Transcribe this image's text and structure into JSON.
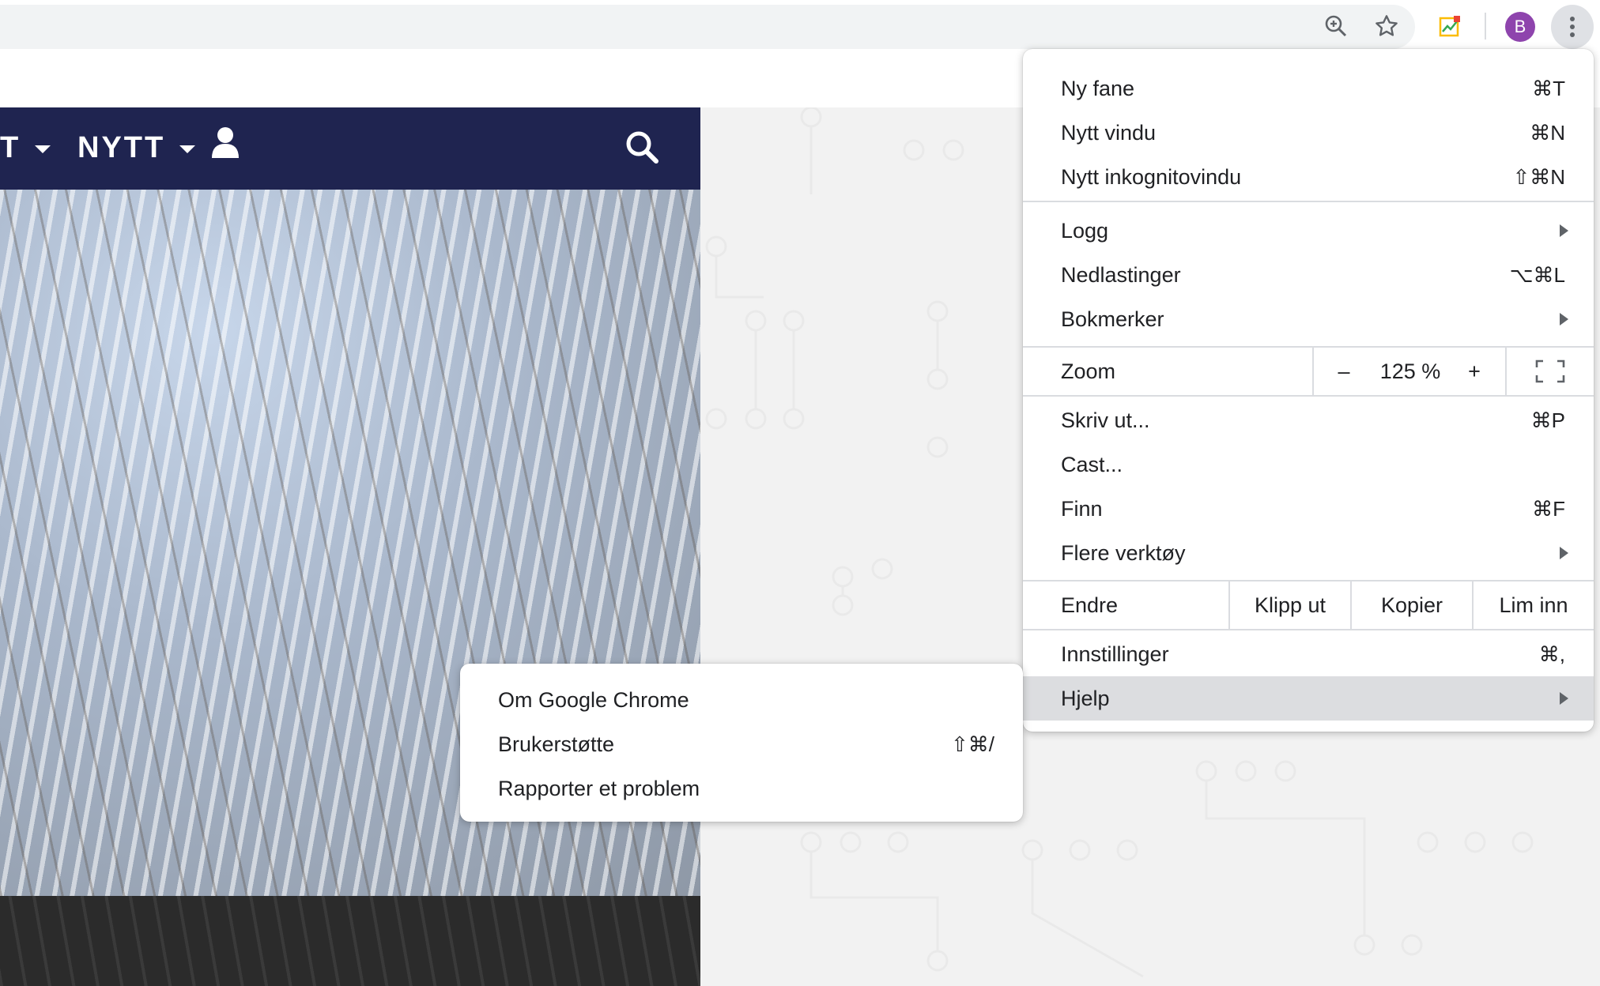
{
  "toolbar": {
    "zoom_icon": "zoom-in-icon",
    "star_icon": "star-icon",
    "extension_icon": "extension-icon",
    "avatar_letter": "B",
    "menu_icon": "kebab-icon"
  },
  "site_nav": {
    "items": [
      {
        "label": "T"
      },
      {
        "label": "NYTT"
      }
    ],
    "user_icon": "user-icon",
    "search_icon": "search-icon"
  },
  "main_menu": {
    "new_tab": {
      "label": "Ny fane",
      "shortcut": "⌘T"
    },
    "new_window": {
      "label": "Nytt vindu",
      "shortcut": "⌘N"
    },
    "incognito": {
      "label": "Nytt inkognitovindu",
      "shortcut": "⇧⌘N"
    },
    "history": {
      "label": "Logg"
    },
    "downloads": {
      "label": "Nedlastinger",
      "shortcut": "⌥⌘L"
    },
    "bookmarks": {
      "label": "Bokmerker"
    },
    "zoom": {
      "label": "Zoom",
      "minus": "–",
      "value": "125 %",
      "plus": "+"
    },
    "print": {
      "label": "Skriv ut...",
      "shortcut": "⌘P"
    },
    "cast": {
      "label": "Cast..."
    },
    "find": {
      "label": "Finn",
      "shortcut": "⌘F"
    },
    "more_tools": {
      "label": "Flere verktøy"
    },
    "edit": {
      "label": "Endre",
      "cut": "Klipp ut",
      "copy": "Kopier",
      "paste": "Lim inn"
    },
    "settings": {
      "label": "Innstillinger",
      "shortcut": "⌘,"
    },
    "help": {
      "label": "Hjelp"
    }
  },
  "help_submenu": {
    "about": {
      "label": "Om Google Chrome"
    },
    "support": {
      "label": "Brukerstøtte",
      "shortcut": "⇧⌘/"
    },
    "report": {
      "label": "Rapporter et problem"
    }
  },
  "colors": {
    "nav_bg": "#1f2450",
    "highlight": "#dcdde0",
    "avatar": "#8e44ad"
  }
}
